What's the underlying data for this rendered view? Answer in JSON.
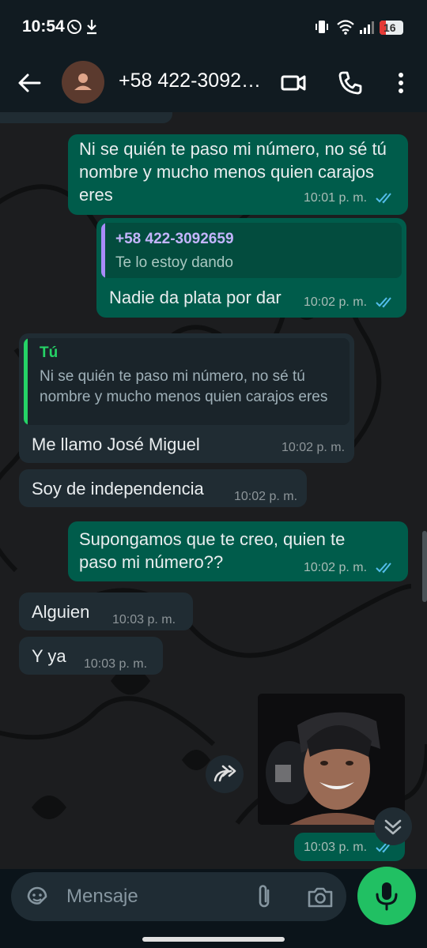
{
  "status_bar": {
    "time": "10:54",
    "battery": "16"
  },
  "header": {
    "contact_name": "+58 422-3092…"
  },
  "messages": [
    {
      "dir": "out",
      "text": "Ni se quién te paso mi número, no sé tú nombre y mucho menos quien carajos eres",
      "time": "10:01 p. m."
    },
    {
      "dir": "out",
      "quote_name": "+58 422-3092659",
      "quote_text": "Te lo estoy dando",
      "text": "Nadie da plata por dar",
      "time": "10:02 p. m."
    },
    {
      "dir": "in",
      "quote_name": "Tú",
      "quote_text": "Ni se quién te paso mi número, no sé tú nombre y mucho menos quien carajos eres",
      "text": "Me llamo José Miguel",
      "time": "10:02 p. m."
    },
    {
      "dir": "in",
      "text": "Soy de independencia",
      "time": "10:02 p. m."
    },
    {
      "dir": "out",
      "text": "Supongamos que te creo, quien te paso mi número??",
      "time": "10:02 p. m."
    },
    {
      "dir": "in",
      "text": "Alguien",
      "time": "10:03 p. m."
    },
    {
      "dir": "in",
      "text": "Y ya",
      "time": "10:03 p. m."
    },
    {
      "dir": "out",
      "kind": "image",
      "time": "10:03 p. m."
    }
  ],
  "composer": {
    "placeholder": "Mensaje"
  },
  "colors": {
    "outgoing_bubble": "#005c4b",
    "incoming_bubble": "#202c33",
    "accent_green": "#21c063",
    "read_ticks": "#53bdeb",
    "quote_purple": "#a78bfa",
    "quote_green": "#25d366"
  },
  "icons": [
    "back-arrow-icon",
    "video-call-icon",
    "phone-icon",
    "more-vert-icon",
    "sticker-icon",
    "attach-icon",
    "camera-icon",
    "mic-icon",
    "forward-icon",
    "scroll-down-icon",
    "whatsapp-icon",
    "download-icon"
  ]
}
